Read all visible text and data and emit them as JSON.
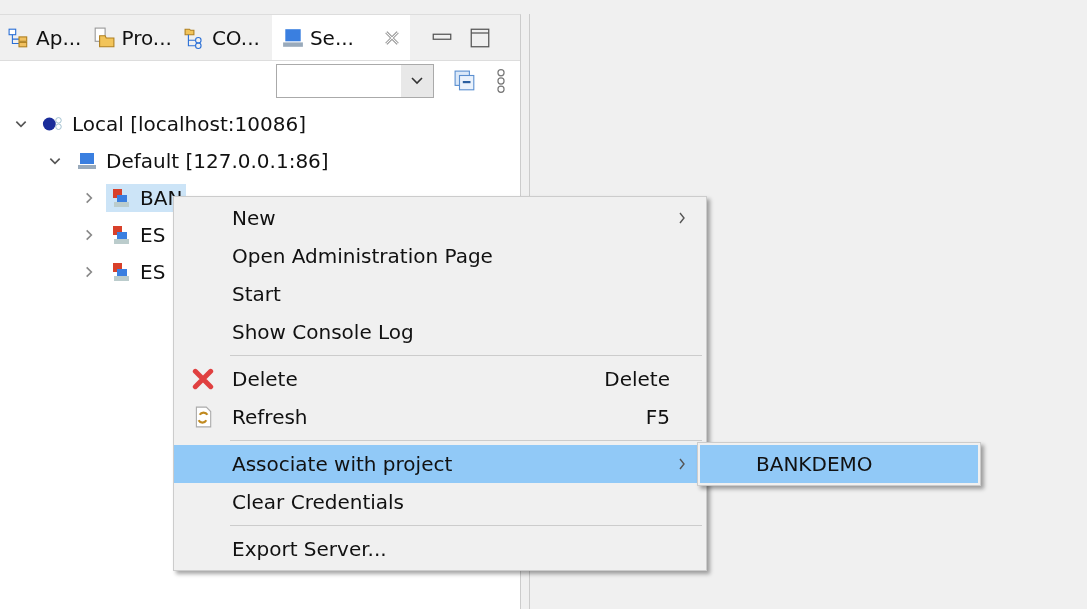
{
  "tabs": [
    {
      "label": "Ap...",
      "selected": false
    },
    {
      "label": "Pro...",
      "selected": false
    },
    {
      "label": "CO...",
      "selected": false
    },
    {
      "label": "Se...",
      "selected": true
    }
  ],
  "tree": [
    {
      "label": "Local [localhost:10086]",
      "expanded": true,
      "selected": false,
      "children": [
        {
          "label": "Default [127.0.0.1:86]",
          "expanded": true,
          "selected": false,
          "children": [
            {
              "label": "BAN",
              "expanded": false,
              "selected": true
            },
            {
              "label": "ES",
              "expanded": false,
              "selected": false
            },
            {
              "label": "ES",
              "expanded": false,
              "selected": false
            }
          ]
        }
      ]
    }
  ],
  "context_menu": {
    "groups": [
      [
        {
          "label": "New",
          "submenu": true,
          "selected": false
        },
        {
          "label": "Open Administration Page",
          "submenu": false,
          "selected": false
        },
        {
          "label": "Start",
          "submenu": false,
          "selected": false
        },
        {
          "label": "Show Console Log",
          "submenu": false,
          "selected": false
        }
      ],
      [
        {
          "label": "Delete",
          "shortcut": "Delete",
          "submenu": false,
          "selected": false
        },
        {
          "label": "Refresh",
          "shortcut": "F5",
          "submenu": false,
          "selected": false
        }
      ],
      [
        {
          "label": "Associate with project",
          "submenu": true,
          "selected": true
        },
        {
          "label": "Clear Credentials",
          "submenu": false,
          "selected": false
        }
      ],
      [
        {
          "label": "Export Server...",
          "submenu": false,
          "selected": false
        }
      ]
    ]
  },
  "submenu": {
    "items": [
      {
        "label": "BANKDEMO",
        "selected": true
      }
    ]
  }
}
